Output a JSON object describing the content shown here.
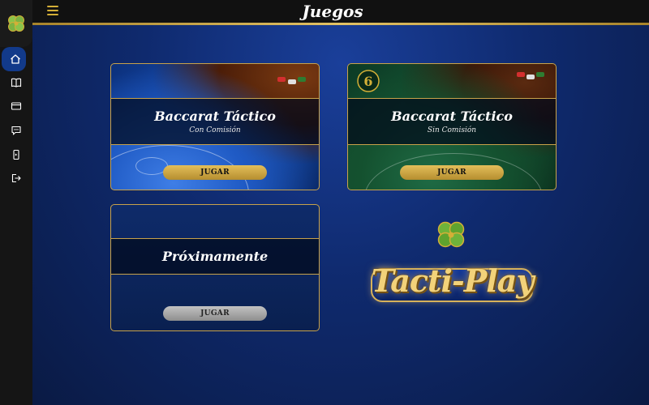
{
  "header": {
    "title": "Juegos"
  },
  "sidebar": {
    "items": [
      {
        "name": "home",
        "icon": "home-icon",
        "active": true
      },
      {
        "name": "rules",
        "icon": "book-icon",
        "active": false
      },
      {
        "name": "payments",
        "icon": "card-icon",
        "active": false
      },
      {
        "name": "chat",
        "icon": "chat-icon",
        "active": false
      },
      {
        "name": "mobile",
        "icon": "phone-icon",
        "active": false
      },
      {
        "name": "logout",
        "icon": "logout-icon",
        "active": false
      }
    ]
  },
  "games": [
    {
      "title": "Baccarat Táctico",
      "subtitle": "Con Comisión",
      "button": "JUGAR",
      "enabled": true
    },
    {
      "title": "Baccarat Táctico",
      "subtitle": "Sin Comisión",
      "button": "JUGAR",
      "enabled": true
    },
    {
      "title": "Próximamente",
      "subtitle": "",
      "button": "JUGAR",
      "enabled": false
    }
  ],
  "brand": {
    "name": "Tacti-Play"
  },
  "colors": {
    "gold": "#c8a24a",
    "accent_blue": "#123a8a",
    "bg_dark": "#151515"
  }
}
